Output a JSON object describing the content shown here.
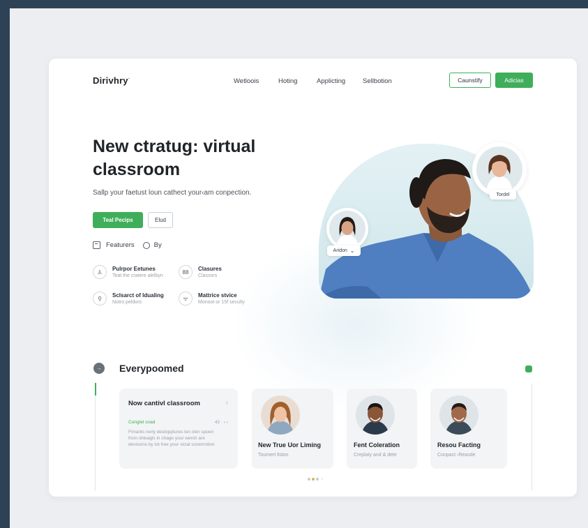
{
  "brand": {
    "name": "Dirivhry",
    "mark": "·"
  },
  "nav": [
    "Wetloois",
    "Hoting",
    "Applicting",
    "Sellbotion"
  ],
  "header_buttons": {
    "secondary": "Caunstify",
    "primary": "Adicias"
  },
  "hero": {
    "title": "New ctratug: virtual classroom",
    "subtitle": "Sallp your faetust loun cathect your‹am conpection.",
    "primary_button": "Teal Pecips",
    "secondary_button": "Elud",
    "toggle_left": "Featurers",
    "toggle_right": "By"
  },
  "features": [
    {
      "icon": "user-icon",
      "glyph": "♙",
      "title": "Pulrpor Eetunes",
      "desc": "Teat the cratere alelbyn"
    },
    {
      "icon": "grid-icon",
      "glyph": "88",
      "title": "Clasures",
      "desc": "Classors"
    },
    {
      "icon": "location-icon",
      "glyph": "⚲",
      "title": "Sclsarct of Idualing",
      "desc": "Notro peldors"
    },
    {
      "icon": "wifi-icon",
      "glyph": "ᯤ",
      "title": "Mattrice stvice",
      "desc": "Monoot or 15f seculty"
    }
  ],
  "hero_image": {
    "tag_top": "Tordel",
    "tag_left": "Aridon",
    "tag_left_chevron": "⌄"
  },
  "section": {
    "icon_glyph": "→",
    "title": "Everypoomed"
  },
  "big_card": {
    "title": "Now cantivl classroom",
    "chevron": "›",
    "green": "Congtel snad",
    "num": "42 · › ›",
    "desc": "Fimants nerly destopptures lun clen spoen from shleagls in chage your werch are devisions by tot free your vicial scnemntion"
  },
  "cards": [
    {
      "name": "New True Uor Liming",
      "sub": "Toumert ltslon"
    },
    {
      "name": "Fent Coleration",
      "sub": "Creplaty and & dete"
    },
    {
      "name": "Resou Facting",
      "sub": "Conpact ‹Reasde"
    }
  ],
  "pagination": {
    "arrow": "›"
  },
  "colors": {
    "accent": "#3fae5a",
    "page_bg": "#2e4256",
    "card_bg": "#ffffff"
  }
}
